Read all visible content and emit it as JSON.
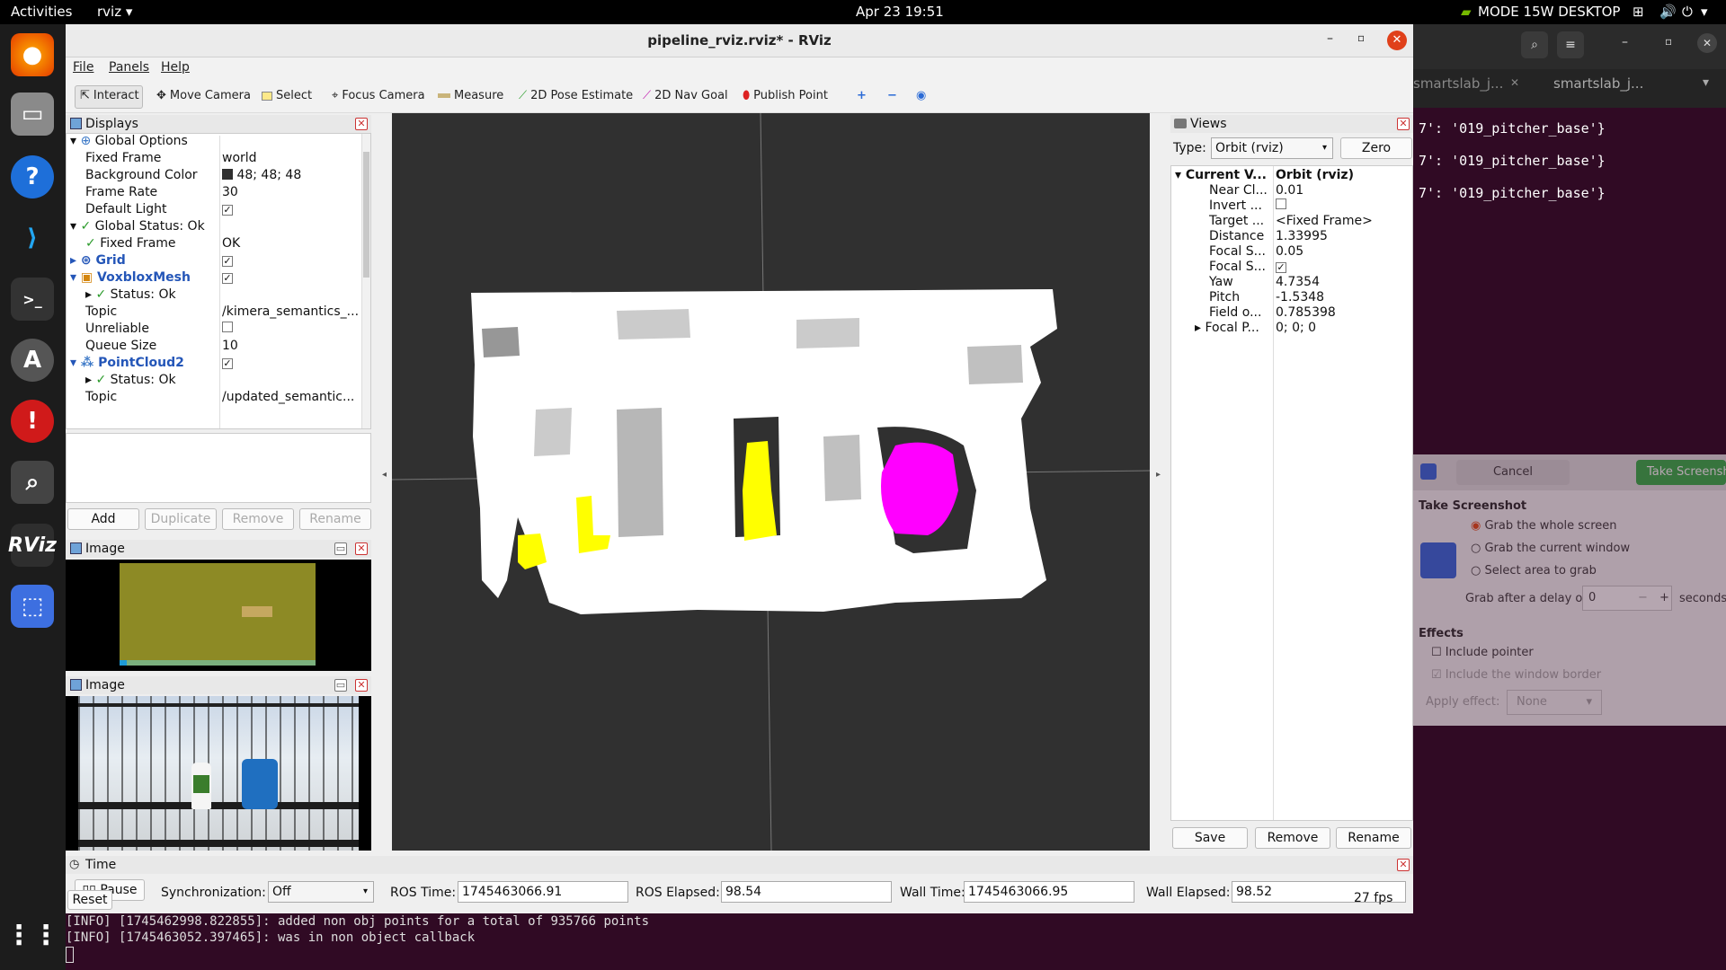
{
  "topbar": {
    "activities": "Activities",
    "app": "rviz ▾",
    "datetime": "Apr 23  19:51",
    "mode": "MODE 15W DESKTOP"
  },
  "window": {
    "title": "pipeline_rviz.rviz* - RViz"
  },
  "menu": [
    "File",
    "Panels",
    "Help"
  ],
  "toolbar": {
    "interact": "Interact",
    "move_camera": "Move Camera",
    "select": "Select",
    "focus_camera": "Focus Camera",
    "measure": "Measure",
    "pose_estimate": "2D Pose Estimate",
    "nav_goal": "2D Nav Goal",
    "publish_point": "Publish Point"
  },
  "displays": {
    "title": "Displays",
    "rows": [
      {
        "label": "Global Options",
        "value": ""
      },
      {
        "label": "Fixed Frame",
        "value": "world"
      },
      {
        "label": "Background Color",
        "value": "48; 48; 48"
      },
      {
        "label": "Frame Rate",
        "value": "30"
      },
      {
        "label": "Default Light",
        "value": "✓"
      },
      {
        "label": "Global Status: Ok",
        "value": ""
      },
      {
        "label": "Fixed Frame",
        "value": "OK"
      },
      {
        "label": "Grid",
        "value": "✓"
      },
      {
        "label": "VoxbloxMesh",
        "value": "✓"
      },
      {
        "label": "Status: Ok",
        "value": ""
      },
      {
        "label": "Topic",
        "value": "/kimera_semantics_..."
      },
      {
        "label": "Unreliable",
        "value": ""
      },
      {
        "label": "Queue Size",
        "value": "10"
      },
      {
        "label": "PointCloud2",
        "value": "✓"
      },
      {
        "label": "Status: Ok",
        "value": ""
      },
      {
        "label": "Topic",
        "value": "/updated_semantic..."
      }
    ],
    "buttons": {
      "add": "Add",
      "duplicate": "Duplicate",
      "remove": "Remove",
      "rename": "Rename"
    }
  },
  "image_panel_1": {
    "title": "Image"
  },
  "image_panel_2": {
    "title": "Image"
  },
  "views": {
    "title": "Views",
    "type_label": "Type:",
    "type_value": "Orbit (rviz)",
    "zero": "Zero",
    "rows": [
      {
        "label": "Current V...",
        "value": "Orbit (rviz)"
      },
      {
        "label": "Near Cl...",
        "value": "0.01"
      },
      {
        "label": "Invert ...",
        "value": ""
      },
      {
        "label": "Target ...",
        "value": "<Fixed Frame>"
      },
      {
        "label": "Distance",
        "value": "1.33995"
      },
      {
        "label": "Focal S...",
        "value": "0.05"
      },
      {
        "label": "Focal S...",
        "value": "✓"
      },
      {
        "label": "Yaw",
        "value": "4.7354"
      },
      {
        "label": "Pitch",
        "value": "-1.5348"
      },
      {
        "label": "Field o...",
        "value": "0.785398"
      },
      {
        "label": "Focal P...",
        "value": "0; 0; 0"
      }
    ],
    "buttons": {
      "save": "Save",
      "remove": "Remove",
      "rename": "Rename"
    }
  },
  "time": {
    "title": "Time",
    "pause": "Pause",
    "sync_label": "Synchronization:",
    "sync_value": "Off",
    "ros_time_label": "ROS Time:",
    "ros_time": "1745463066.91",
    "ros_elapsed_label": "ROS Elapsed:",
    "ros_elapsed": "98.54",
    "wall_time_label": "Wall Time:",
    "wall_time": "1745463066.95",
    "wall_elapsed_label": "Wall Elapsed:",
    "wall_elapsed": "98.52",
    "reset": "Reset",
    "fps": "27 fps"
  },
  "terminal": {
    "tab1": "smartslab_j...",
    "tab2": "smartslab_j...",
    "lines": [
      "7': '019_pitcher_base'}",
      "7': '019_pitcher_base'}",
      "7': '019_pitcher_base'}"
    ]
  },
  "screenshot_dialog": {
    "cancel": "Cancel",
    "take": "Take Screensho",
    "heading": "Take Screenshot",
    "opt1": "Grab the whole screen",
    "opt2": "Grab the current window",
    "opt3": "Select area to grab",
    "delay_label": "Grab after a delay of",
    "delay_value": "0",
    "seconds": "seconds",
    "effects": "Effects",
    "pointer": "Include pointer",
    "border": "Include the window border",
    "apply": "Apply effect:",
    "apply_value": "None"
  },
  "console": [
    "[INFO] [1745462998.822855]: added non obj points for a total of 935766 points",
    "[INFO] [1745463052.397465]: was in non object callback"
  ]
}
